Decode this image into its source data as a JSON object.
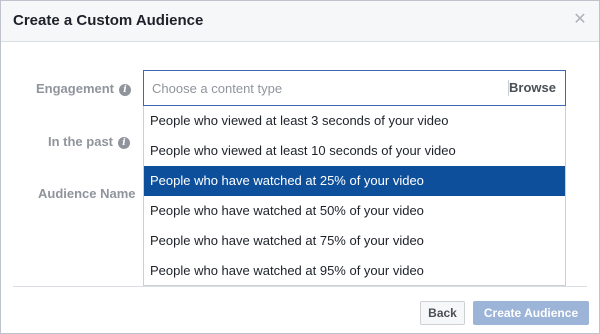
{
  "dialog": {
    "title": "Create a Custom Audience"
  },
  "form": {
    "engagement_label": "Engagement",
    "in_the_past_label": "In the past",
    "audience_name_label": "Audience Name",
    "info_glyph": "i",
    "content_type": {
      "placeholder": "Choose a content type",
      "browse_label": "Browse"
    }
  },
  "dropdown": {
    "options": [
      "People who viewed at least 3 seconds of your video",
      "People who viewed at least 10 seconds of your video",
      "People who have watched at 25% of your video",
      "People who have watched at 50% of your video",
      "People who have watched at 75% of your video",
      "People who have watched at 95% of your video"
    ],
    "selected_index": 2
  },
  "footer": {
    "back_label": "Back",
    "create_label": "Create Audience"
  },
  "colors": {
    "accent": "#4267b2",
    "selected_row": "#0e4f9b",
    "disabled_button": "#9cb4d8"
  }
}
